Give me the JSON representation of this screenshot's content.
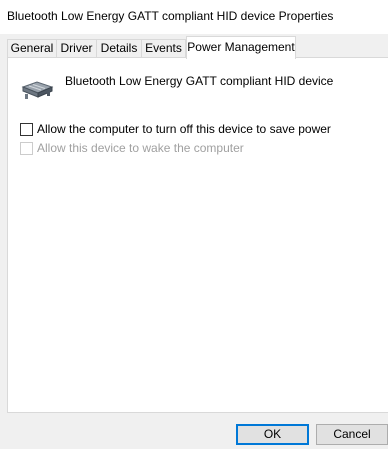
{
  "window": {
    "title": "Bluetooth Low Energy GATT compliant HID device Properties"
  },
  "tabs": [
    {
      "label": "General"
    },
    {
      "label": "Driver"
    },
    {
      "label": "Details"
    },
    {
      "label": "Events"
    },
    {
      "label": "Power Management",
      "active": true
    }
  ],
  "device": {
    "icon": "bluetooth-device-icon",
    "name": "Bluetooth Low Energy GATT compliant HID device"
  },
  "options": {
    "allow_turn_off": {
      "label": "Allow the computer to turn off this device to save power",
      "checked": false,
      "enabled": true
    },
    "allow_wake": {
      "label": "Allow this device to wake the computer",
      "checked": false,
      "enabled": false
    }
  },
  "buttons": {
    "ok": "OK",
    "cancel": "Cancel"
  },
  "colors": {
    "accent": "#0078d7",
    "disabled_text": "#a0a0a0"
  }
}
